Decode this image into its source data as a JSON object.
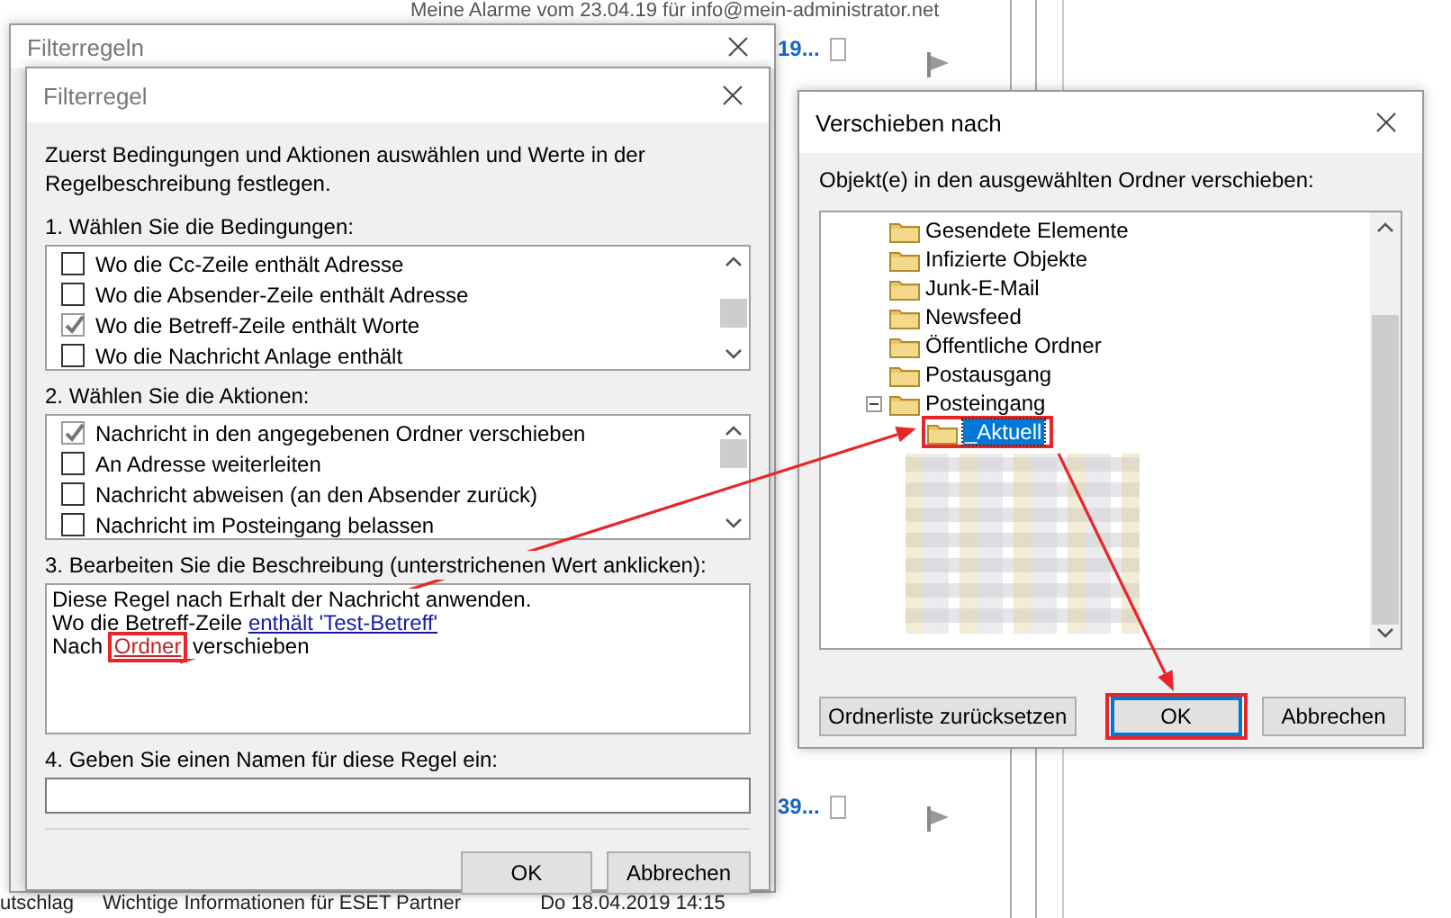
{
  "background": {
    "header_text": "Meine Alarme vom 23.04.19 für info@mein-administrator.net",
    "row_snippets": [
      {
        "text": "19...",
        "checked": false
      },
      {
        "text": "39...",
        "checked": false
      }
    ],
    "footer_row": [
      "utschlag",
      "Wichtige Informationen für ESET Partner",
      "Do 18.04.2019 14:15"
    ]
  },
  "rules_window": {
    "title": "Filterregeln"
  },
  "rule_dialog": {
    "title": "Filterregel",
    "intro": "Zuerst Bedingungen und Aktionen auswählen und Werte in der Regelbeschreibung festlegen.",
    "conditions_label": "1. Wählen Sie die Bedingungen:",
    "conditions": [
      {
        "label": "Wo die Cc-Zeile enthält Adresse",
        "checked": false
      },
      {
        "label": "Wo die Absender-Zeile enthält Adresse",
        "checked": false
      },
      {
        "label": "Wo die Betreff-Zeile enthält Worte",
        "checked": true
      },
      {
        "label": "Wo die Nachricht Anlage enthält",
        "checked": false
      }
    ],
    "actions_label": "2. Wählen Sie die Aktionen:",
    "actions": [
      {
        "label": "Nachricht in den angegebenen Ordner verschieben",
        "checked": true
      },
      {
        "label": "An Adresse weiterleiten",
        "checked": false
      },
      {
        "label": "Nachricht abweisen (an den Absender zurück)",
        "checked": false
      },
      {
        "label": "Nachricht im Posteingang belassen",
        "checked": false
      }
    ],
    "description_label": "3. Bearbeiten Sie die Beschreibung (unterstrichenen Wert anklicken):",
    "description": [
      [
        {
          "text": "Diese Regel nach Erhalt der Nachricht anwenden.",
          "kind": "plain"
        }
      ],
      [
        {
          "text": "Wo die Betreff-Zeile ",
          "kind": "plain"
        },
        {
          "text": "enthält 'Test-Betreff'",
          "kind": "value"
        }
      ],
      [
        {
          "text": "Nach ",
          "kind": "plain"
        },
        {
          "text": "Ordner",
          "kind": "unset",
          "highlighted": true
        },
        {
          "text": " verschieben",
          "kind": "plain"
        }
      ]
    ],
    "name_label": "4. Geben Sie einen Namen für diese Regel ein:",
    "buttons": [
      {
        "label": "OK"
      },
      {
        "label": "Abbrechen"
      }
    ]
  },
  "move_dialog": {
    "title": "Verschieben nach",
    "label": "Objekt(e) in den ausgewählten Ordner verschieben:",
    "folders": [
      {
        "label": "Gesendete Elemente",
        "selected": false
      },
      {
        "label": "Infizierte Objekte",
        "selected": false
      },
      {
        "label": "Junk-E-Mail",
        "selected": false
      },
      {
        "label": "Newsfeed",
        "selected": false
      },
      {
        "label": "Öffentliche Ordner",
        "selected": false
      },
      {
        "label": "Postausgang",
        "selected": false
      },
      {
        "label": "Posteingang",
        "selected": false,
        "expanded": true,
        "children": [
          {
            "label": "_Aktuell",
            "selected": true,
            "highlighted": true
          }
        ]
      }
    ],
    "buttons": [
      {
        "label": "Ordnerliste zurücksetzen",
        "highlighted": false
      },
      {
        "label": "OK",
        "highlighted": true,
        "default": true
      },
      {
        "label": "Abbrechen",
        "highlighted": false
      }
    ]
  }
}
